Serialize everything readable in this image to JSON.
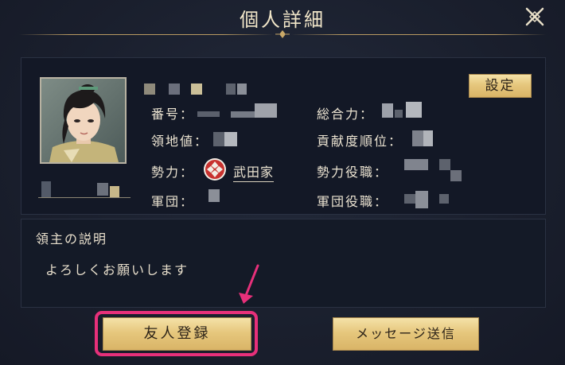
{
  "header": {
    "title": "個人詳細"
  },
  "profile": {
    "settings_label": "設定",
    "fields": {
      "number_label": "番号：",
      "territory_label": "領地値：",
      "faction_label": "勢力：",
      "faction_value": "武田家",
      "corps_label": "軍団：",
      "total_power_label": "総合力：",
      "contribution_label": "貢献度順位：",
      "faction_role_label": "勢力役職：",
      "corps_role_label": "軍団役職："
    }
  },
  "description": {
    "title": "領主の説明",
    "text": "よろしくお願いします"
  },
  "actions": {
    "friend_label": "友人登録",
    "message_label": "メッセージ送信"
  },
  "colors": {
    "highlight": "#e7307a",
    "button_gold": "#e6c77d",
    "panel": "#131826"
  }
}
